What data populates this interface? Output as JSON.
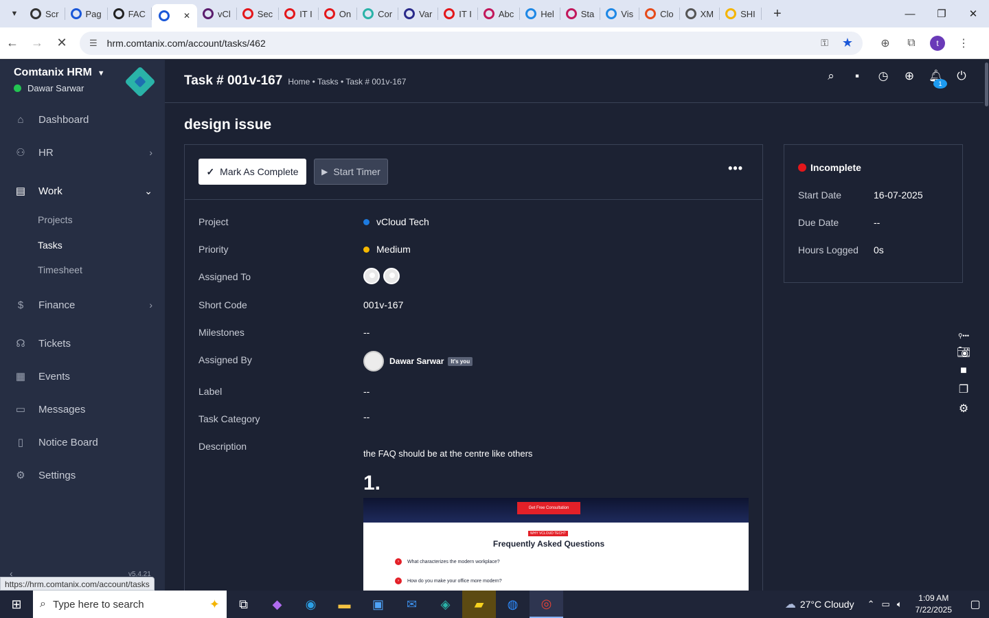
{
  "browser": {
    "tabs": [
      {
        "label": "Scr",
        "color": "#333333"
      },
      {
        "label": "Pag",
        "color": "#1a57d8"
      },
      {
        "label": "FAC",
        "color": "#222222"
      },
      {
        "label": "",
        "color": "#1a57d8",
        "active": true
      },
      {
        "label": "vCl",
        "color": "#5b1d6d"
      },
      {
        "label": "Sec",
        "color": "#e3171b"
      },
      {
        "label": "IT I",
        "color": "#e3171b"
      },
      {
        "label": "On",
        "color": "#e3171b"
      },
      {
        "label": "Cor",
        "color": "#2ab3a8"
      },
      {
        "label": "Var",
        "color": "#2a2a8a"
      },
      {
        "label": "IT I",
        "color": "#e3171b"
      },
      {
        "label": "Abc",
        "color": "#c2185b"
      },
      {
        "label": "Hel",
        "color": "#1e88e5"
      },
      {
        "label": "Sta",
        "color": "#c2185b"
      },
      {
        "label": "Vis",
        "color": "#1e88e5"
      },
      {
        "label": "Clo",
        "color": "#e64a19"
      },
      {
        "label": "XM",
        "color": "#555555"
      },
      {
        "label": "SHI",
        "color": "#f4b400"
      }
    ],
    "url": "hrm.comtanix.com/account/tasks/462",
    "status_url": "https://hrm.comtanix.com/account/tasks",
    "profile_initial": "t"
  },
  "sidebar": {
    "brand": "Comtanix HRM",
    "user": "Dawar Sarwar",
    "version": "v5.4.21",
    "items": [
      {
        "label": "Dashboard",
        "icon": "home-icon"
      },
      {
        "label": "HR",
        "icon": "users-icon"
      },
      {
        "label": "Work",
        "icon": "briefcase-icon"
      },
      {
        "label": "Finance",
        "icon": "dollar-icon"
      },
      {
        "label": "Tickets",
        "icon": "headset-icon"
      },
      {
        "label": "Events",
        "icon": "calendar-icon"
      },
      {
        "label": "Messages",
        "icon": "chat-icon"
      },
      {
        "label": "Notice Board",
        "icon": "clipboard-icon"
      },
      {
        "label": "Settings",
        "icon": "gear-icon"
      }
    ],
    "work_sub": [
      "Projects",
      "Tasks",
      "Timesheet"
    ]
  },
  "header": {
    "title": "Task # 001v-167",
    "breadcrumb": "Home • Tasks • Task # 001v-167",
    "notification_count": "1"
  },
  "task": {
    "heading": "design issue",
    "mark_complete": "Mark As Complete",
    "start_timer": "Start Timer",
    "fields": {
      "project_label": "Project",
      "project_value": "vCloud Tech",
      "priority_label": "Priority",
      "priority_value": "Medium",
      "assigned_to_label": "Assigned To",
      "short_code_label": "Short Code",
      "short_code_value": "001v-167",
      "milestones_label": "Milestones",
      "milestones_value": "--",
      "assigned_by_label": "Assigned By",
      "assigned_by_value": "Dawar Sarwar",
      "its_you": "It's you",
      "label_label": "Label",
      "label_value": "--",
      "category_label": "Task Category",
      "category_value": "--",
      "description_label": "Description"
    },
    "description": {
      "text": "the FAQ should be at the centre like others",
      "number": "1.",
      "embed_cta": "Get Free Consultation",
      "embed_tag": "WHY VCLOUD TECH?",
      "embed_title": "Frequently Asked Questions",
      "embed_q1": "What characterizes the modern workplace?",
      "embed_q2": "How do you make your office more modern?"
    }
  },
  "info": {
    "status": "Incomplete",
    "start_date_label": "Start Date",
    "start_date": "16-07-2025",
    "due_date_label": "Due Date",
    "due_date": "--",
    "hours_label": "Hours Logged",
    "hours": "0s"
  },
  "taskbar": {
    "search_placeholder": "Type here to search",
    "weather": "27°C  Cloudy",
    "weather_badge": "1",
    "time": "1:09 AM",
    "date": "7/22/2025"
  }
}
